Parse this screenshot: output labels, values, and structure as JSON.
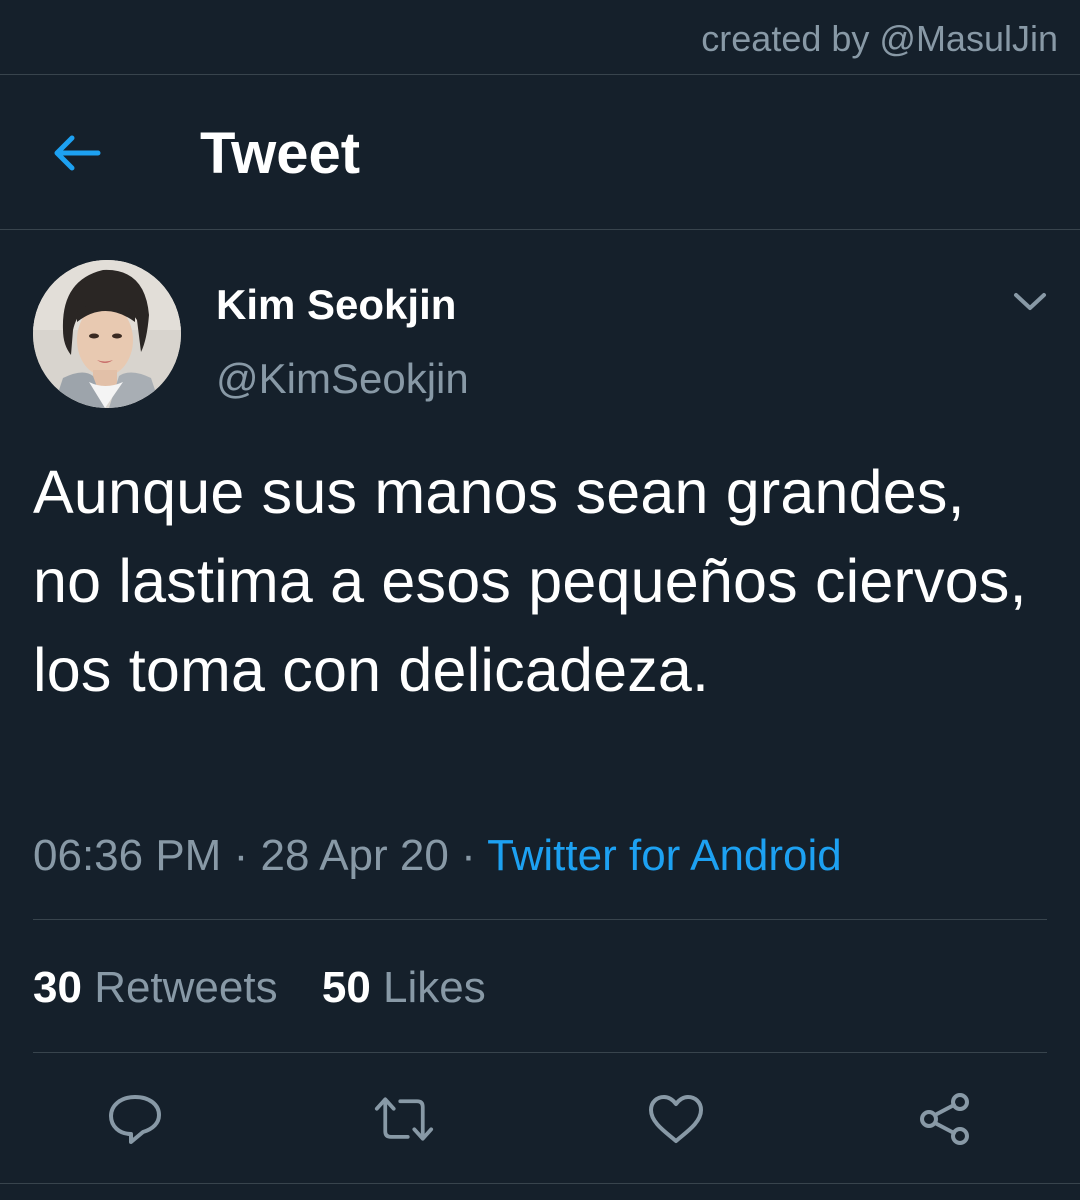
{
  "watermark": "created by @MasulJin",
  "header": {
    "title": "Tweet",
    "back_icon": "arrow-left-icon"
  },
  "author": {
    "display_name": "Kim Seokjin",
    "handle": "@KimSeokjin",
    "more_icon": "chevron-down-icon"
  },
  "tweet": {
    "text": "Aunque sus manos sean grandes, no lastima a esos pequeños ciervos, los toma con delicadeza.",
    "time": "06:36 PM",
    "date": "28 Apr 20",
    "separator": "·",
    "source": "Twitter for Android"
  },
  "stats": {
    "retweets_count": "30",
    "retweets_label": "Retweets",
    "likes_count": "50",
    "likes_label": "Likes"
  },
  "actions": {
    "reply_icon": "reply-icon",
    "retweet_icon": "retweet-icon",
    "like_icon": "heart-icon",
    "share_icon": "share-icon"
  },
  "colors": {
    "background": "#15202b",
    "accent": "#1da1f2",
    "secondary_text": "#8899a6",
    "divider": "#38444d"
  }
}
